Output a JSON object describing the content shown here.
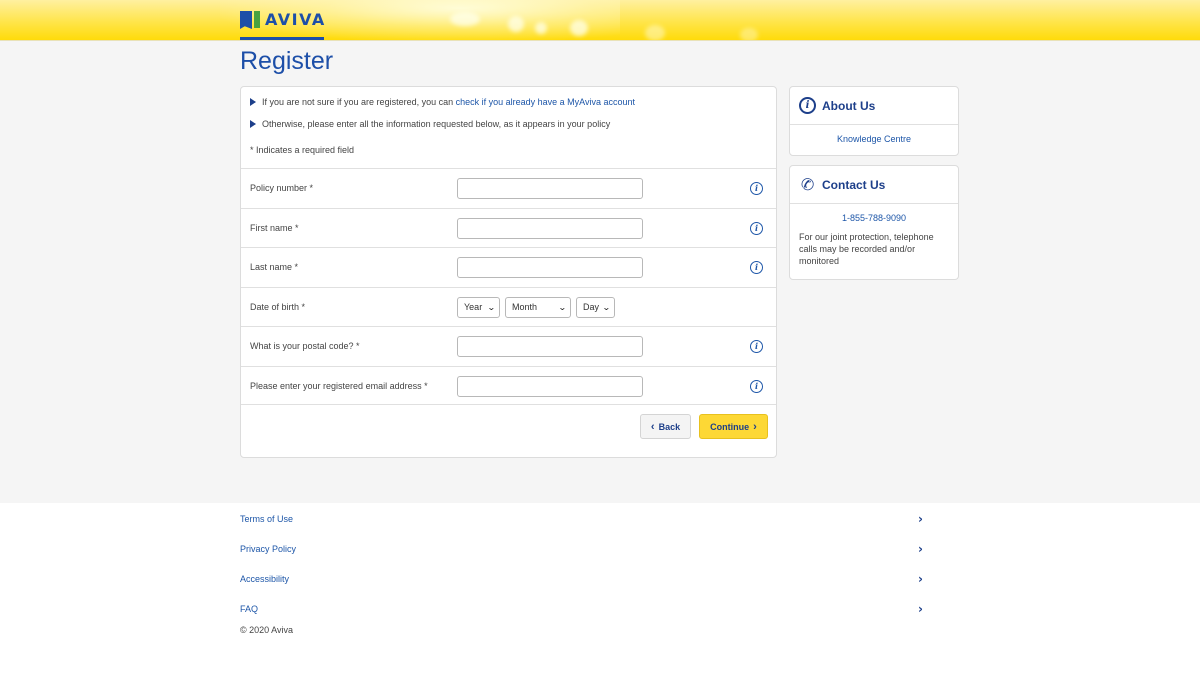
{
  "header": {
    "logo_text": "AVIVA",
    "brand_colors": {
      "blue": "#1d4fa8",
      "green": "#48a23f",
      "yellow": "#ffdb0a"
    }
  },
  "page": {
    "title": "Register"
  },
  "intro": {
    "line1_prefix": "If you are not sure if you are registered, you can ",
    "line1_link": "check if you already have a MyAviva account",
    "line2": "Otherwise, please enter all the information requested below, as it appears in your policy",
    "required_note": "* Indicates a required field"
  },
  "form": {
    "fields": [
      {
        "label": "Policy number *",
        "value": "",
        "has_info": true
      },
      {
        "label": "First name *",
        "value": "",
        "has_info": true
      },
      {
        "label": "Last name *",
        "value": "",
        "has_info": true
      },
      {
        "label": "Date of birth *",
        "type": "date"
      },
      {
        "label": "What is your postal code? *",
        "value": "",
        "has_info": true
      },
      {
        "label": "Please enter your registered email address *",
        "value": "",
        "has_info": true
      }
    ],
    "dob": {
      "year": "Year",
      "month": "Month",
      "day": "Day"
    },
    "back_label": "Back",
    "continue_label": "Continue"
  },
  "sidebar": {
    "about": {
      "title": "About Us",
      "link": "Knowledge Centre"
    },
    "contact": {
      "title": "Contact Us",
      "phone": "1-855-788-9090",
      "note": "For our joint protection, telephone calls may be recorded and/or monitored"
    }
  },
  "footer": {
    "links": [
      "Terms of Use",
      "Privacy Policy",
      "Accessibility",
      "FAQ"
    ],
    "copyright": "© 2020 Aviva"
  }
}
